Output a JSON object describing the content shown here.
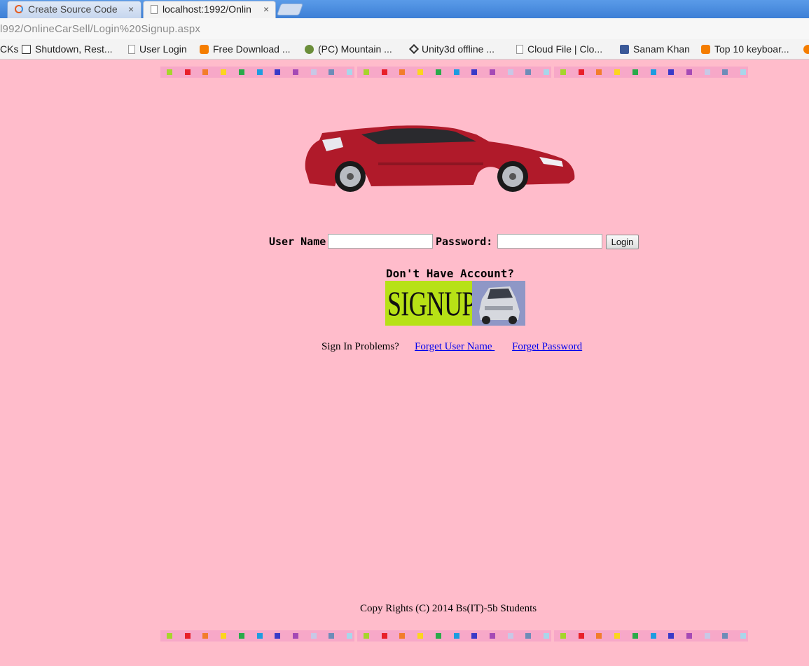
{
  "browser": {
    "tabs": [
      {
        "label": "Create Source Code",
        "close": "×"
      },
      {
        "label": "localhost:1992/Onlin",
        "close": "×"
      }
    ],
    "url": "l992/OnlineCarSell/Login%20Signup.aspx",
    "bookmarks": [
      {
        "label": "CKs",
        "icon": "none"
      },
      {
        "label": "Shutdown, Rest...",
        "icon": "folder-icon"
      },
      {
        "label": "User Login",
        "icon": "page-icon"
      },
      {
        "label": "Free Download ...",
        "icon": "blogger-icon"
      },
      {
        "label": "(PC) Mountain ...",
        "icon": "game-icon"
      },
      {
        "label": "Unity3d offline ...",
        "icon": "unity-icon"
      },
      {
        "label": "Cloud File | Clo...",
        "icon": "page-icon"
      },
      {
        "label": "Sanam Khan",
        "icon": "facebook-icon"
      },
      {
        "label": "Top 10 keyboar...",
        "icon": "blogger-icon"
      }
    ]
  },
  "page": {
    "background": "#ffbccb",
    "strip_colors": [
      "#a6d52c",
      "#e8202a",
      "#f27d2b",
      "#fcd51e",
      "#2aaa4a",
      "#1e9ce0",
      "#3a3ac8",
      "#a54ab5",
      "#c8c8e6",
      "#6e8cb8",
      "#a9d6ea"
    ],
    "login": {
      "username_label": "User Name",
      "password_label": "Password:",
      "username_value": "",
      "password_value": "",
      "login_button": "Login"
    },
    "signup": {
      "prompt": "Don't Have Account?",
      "banner_text": "SIGNUP"
    },
    "problems": {
      "label": "Sign In Problems?",
      "forget_username": "Forget User Name ",
      "forget_password": "Forget Password"
    },
    "copyright": "Copy Rights (C) 2014 Bs(IT)-5b Students"
  }
}
